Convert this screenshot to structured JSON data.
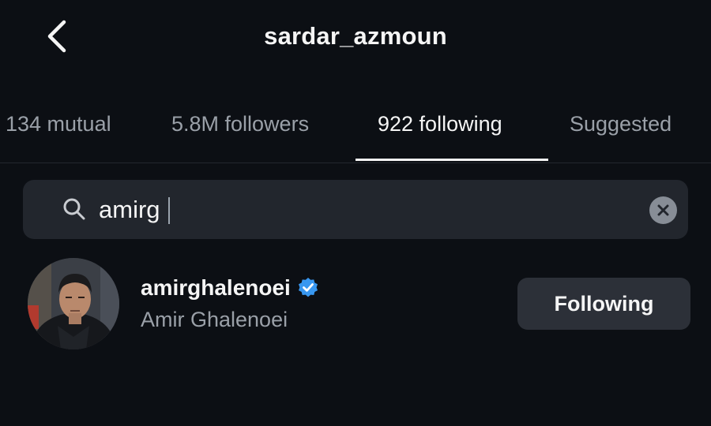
{
  "header": {
    "title": "sardar_azmoun",
    "back_icon": "chevron-left-icon"
  },
  "tabs": [
    {
      "label": "134 mutual",
      "active": false
    },
    {
      "label": "5.8M followers",
      "active": false
    },
    {
      "label": "922 following",
      "active": true
    },
    {
      "label": "Suggested",
      "active": false
    }
  ],
  "search": {
    "icon": "search-icon",
    "value": "amirg",
    "clear_icon": "clear-icon"
  },
  "results": [
    {
      "username": "amirghalenoei",
      "verified": true,
      "full_name": "Amir Ghalenoei",
      "button_label": "Following"
    }
  ],
  "colors": {
    "background": "#0c0f14",
    "search_bg": "#22262d",
    "button_bg": "#2c3038",
    "verified_blue": "#3897f0",
    "muted_text": "#9aa0a8"
  }
}
